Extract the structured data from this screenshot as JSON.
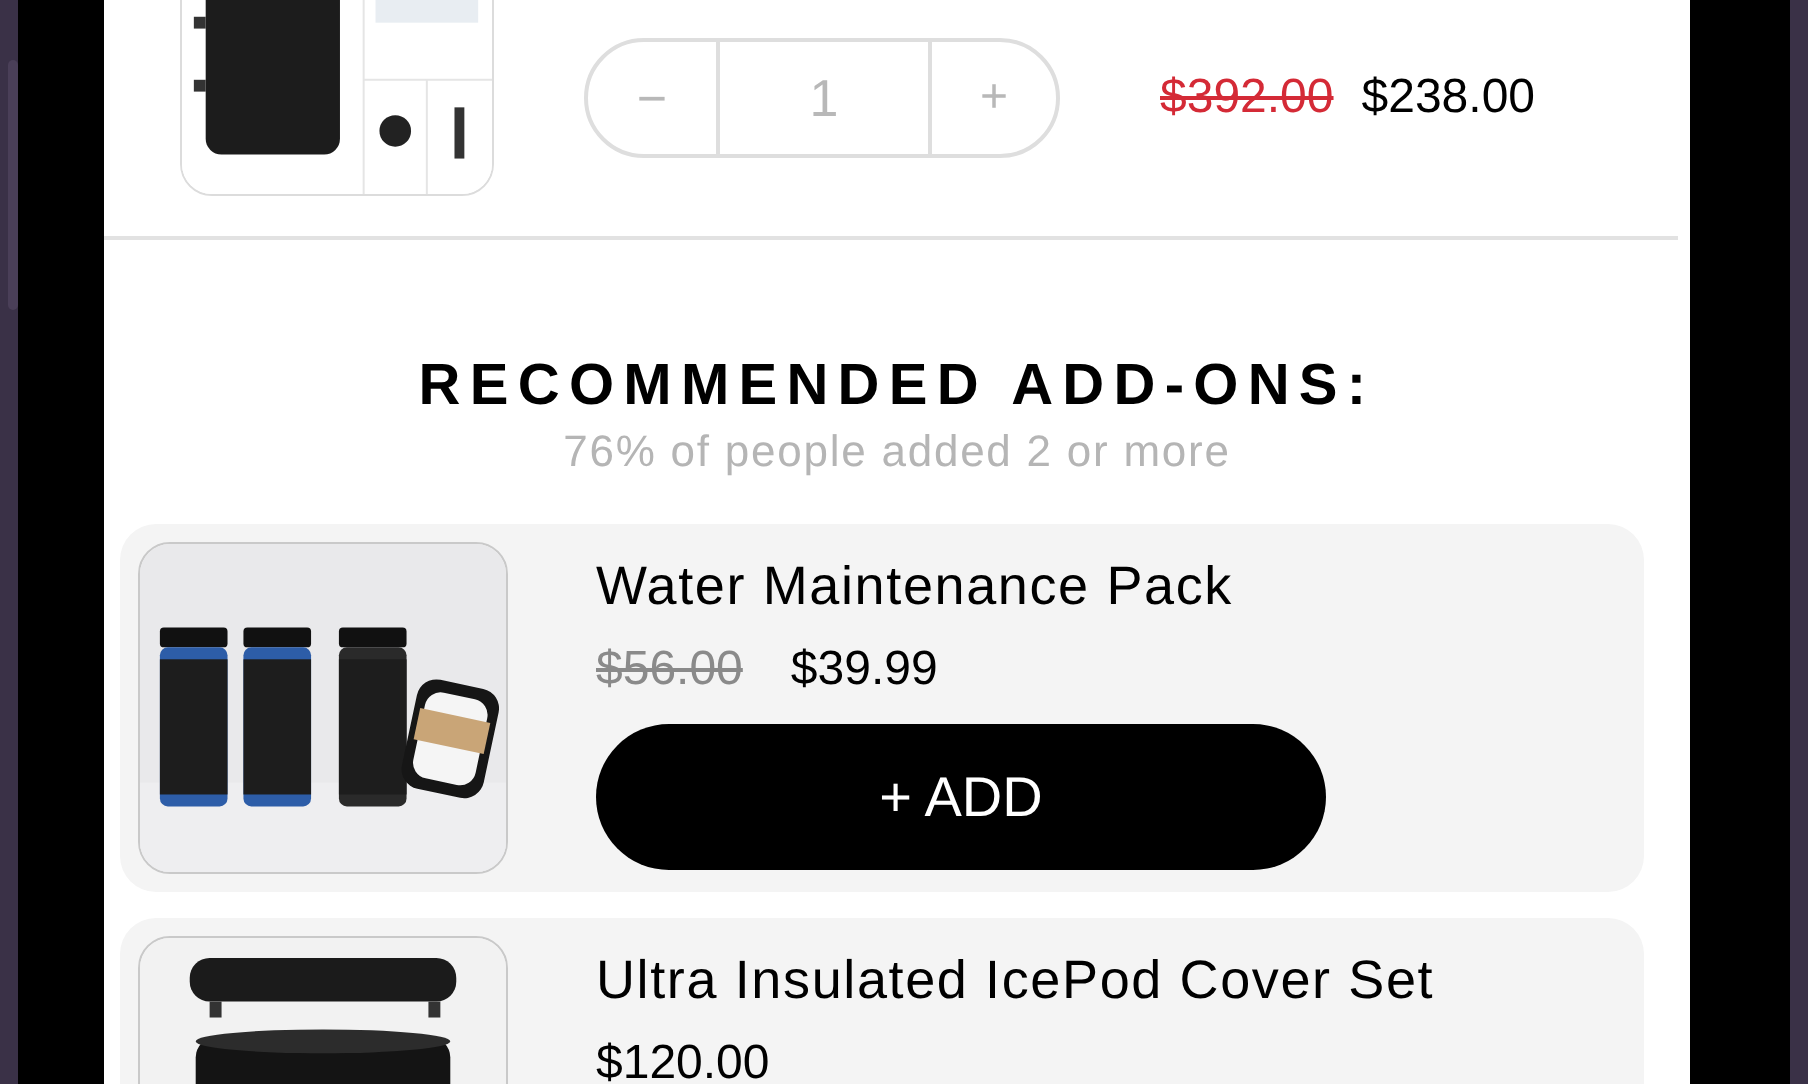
{
  "cart_item": {
    "quantity": {
      "decrement": "−",
      "value": "1",
      "increment": "+"
    },
    "compare_price": "$392.00",
    "price": "$238.00"
  },
  "recommendations": {
    "heading": "RECOMMENDED ADD-ONS:",
    "subheading": "76% of people added 2 or more",
    "items": [
      {
        "kind": "bottles",
        "title": "Water Maintenance Pack",
        "compare_price": "$56.00",
        "price": "$39.99",
        "button": "+ ADD"
      },
      {
        "kind": "cover",
        "title": "Ultra Insulated IcePod Cover Set",
        "price": "$120.00"
      }
    ]
  }
}
